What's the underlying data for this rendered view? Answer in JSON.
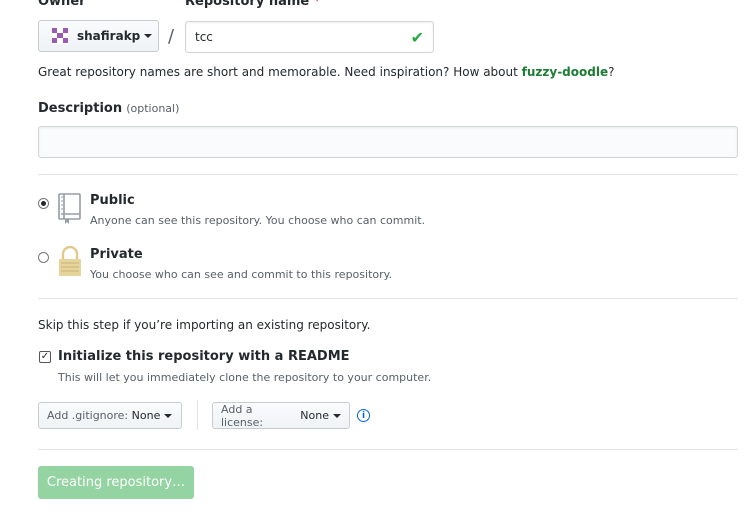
{
  "owner": {
    "label": "Owner",
    "value": "shafirakp"
  },
  "repo_name": {
    "label": "Repository name",
    "required_mark": "*",
    "value": "tcc",
    "valid_icon": "check-icon"
  },
  "separator": "/",
  "hint": {
    "prefix": "Great repository names are short and memorable. Need inspiration? How about ",
    "suggestion": "fuzzy-doodle",
    "suffix": "?"
  },
  "description": {
    "label": "Description",
    "optional": "(optional)",
    "value": ""
  },
  "visibility": {
    "options": [
      {
        "title": "Public",
        "note": "Anyone can see this repository. You choose who can commit.",
        "selected": true,
        "icon": "repo-book-icon"
      },
      {
        "title": "Private",
        "note": "You choose who can see and commit to this repository.",
        "selected": false,
        "icon": "lock-icon"
      }
    ]
  },
  "import_note": "Skip this step if you’re importing an existing repository.",
  "readme": {
    "label": "Initialize this repository with a README",
    "note": "This will let you immediately clone the repository to your computer.",
    "checked": true
  },
  "gitignore": {
    "prefix": "Add .gitignore:",
    "value": "None"
  },
  "license": {
    "prefix": "Add a license:",
    "value": "None"
  },
  "info_icon": "info-icon",
  "submit": {
    "label": "Creating repository…"
  },
  "colors": {
    "accent_green": "#28a745",
    "button_disabled": "#94d3a2",
    "link_blue": "#0366d6"
  }
}
